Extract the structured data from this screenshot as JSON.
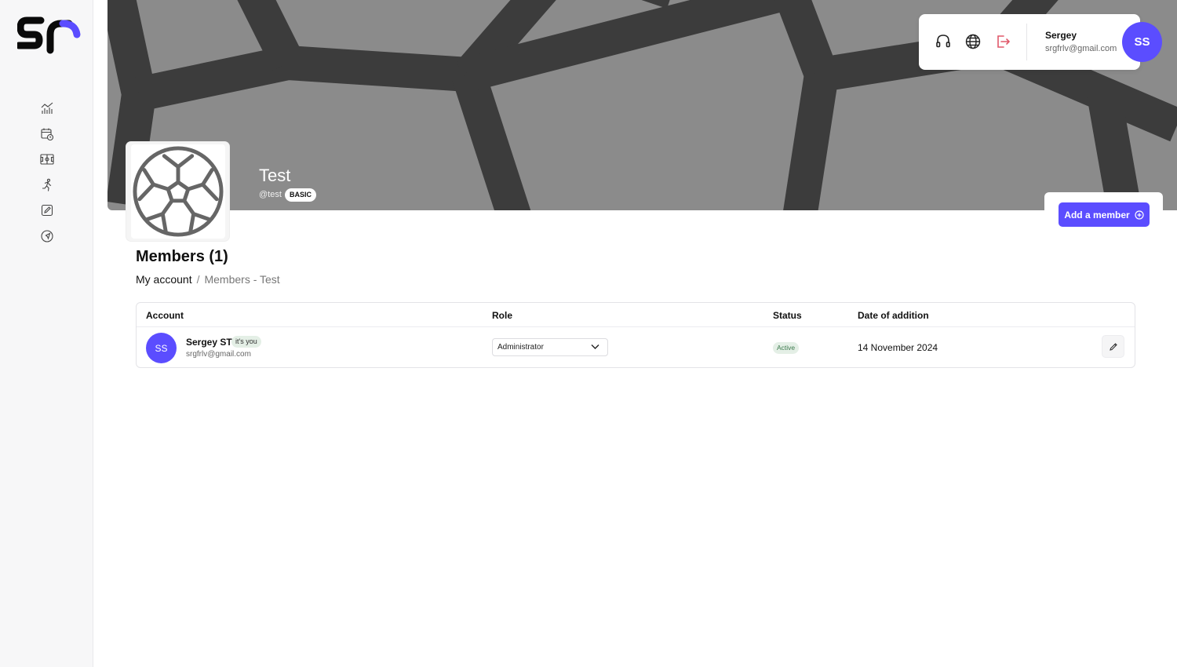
{
  "brand": {
    "logo_text": "ST",
    "accent_color": "#5b4dff",
    "logo_accent_color": "#5b4dff"
  },
  "sidebar": {
    "items": [
      {
        "icon": "analytics-icon"
      },
      {
        "icon": "calendar-clock-icon"
      },
      {
        "icon": "field-icon"
      },
      {
        "icon": "runner-icon"
      },
      {
        "icon": "edit-square-icon"
      },
      {
        "icon": "navigation-icon"
      }
    ]
  },
  "header": {
    "icons": [
      "headset-icon",
      "globe-icon",
      "logout-icon"
    ],
    "user_name": "Sergey",
    "user_email": "srgfrlv@gmail.com",
    "user_initials": "SS"
  },
  "team": {
    "name": "Test",
    "handle": "@test",
    "plan": "BASIC"
  },
  "actions": {
    "add_member_label": "Add a member"
  },
  "page": {
    "title": "Members (1)",
    "breadcrumb": {
      "root": "My account",
      "separator": "/",
      "current": "Members - Test"
    }
  },
  "table": {
    "columns": {
      "account": "Account",
      "role": "Role",
      "status": "Status",
      "date": "Date of addition"
    },
    "rows": [
      {
        "initials": "SS",
        "name": "Sergey ST",
        "self_badge": "it's you",
        "email": "srgfrlv@gmail.com",
        "role": "Administrator",
        "status": "Active",
        "date": "14 November 2024"
      }
    ]
  }
}
